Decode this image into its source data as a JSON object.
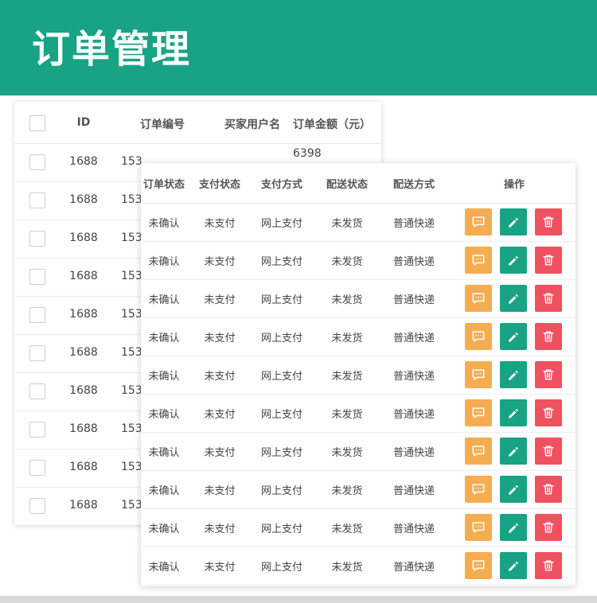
{
  "header": {
    "title": "订单管理"
  },
  "back_table": {
    "columns": [
      "ID",
      "订单编号",
      "买家用户名",
      "订单金额（元）"
    ],
    "rows": [
      {
        "id": "1688",
        "order_no": "153",
        "user": "",
        "amount": ""
      },
      {
        "id": "1688",
        "order_no": "153",
        "user": "",
        "amount": ""
      },
      {
        "id": "1688",
        "order_no": "153",
        "user": "",
        "amount": ""
      },
      {
        "id": "1688",
        "order_no": "153",
        "user": "",
        "amount": ""
      },
      {
        "id": "1688",
        "order_no": "153",
        "user": "",
        "amount": ""
      },
      {
        "id": "1688",
        "order_no": "153",
        "user": "",
        "amount": ""
      },
      {
        "id": "1688",
        "order_no": "153",
        "user": "",
        "amount": ""
      },
      {
        "id": "1688",
        "order_no": "153",
        "user": "",
        "amount": ""
      },
      {
        "id": "1688",
        "order_no": "153",
        "user": "",
        "amount": ""
      },
      {
        "id": "1688",
        "order_no": "153",
        "user": "",
        "amount": ""
      }
    ],
    "first_row_amount": "6398"
  },
  "front_table": {
    "columns": [
      "订单状态",
      "支付状态",
      "支付方式",
      "配送状态",
      "配送方式",
      "操作"
    ],
    "rows": [
      {
        "order_status": "未确认",
        "pay_status": "未支付",
        "pay_method": "网上支付",
        "ship_status": "未发货",
        "ship_method": "普通快递"
      },
      {
        "order_status": "未确认",
        "pay_status": "未支付",
        "pay_method": "网上支付",
        "ship_status": "未发货",
        "ship_method": "普通快递"
      },
      {
        "order_status": "未确认",
        "pay_status": "未支付",
        "pay_method": "网上支付",
        "ship_status": "未发货",
        "ship_method": "普通快递"
      },
      {
        "order_status": "未确认",
        "pay_status": "未支付",
        "pay_method": "网上支付",
        "ship_status": "未发货",
        "ship_method": "普通快递"
      },
      {
        "order_status": "未确认",
        "pay_status": "未支付",
        "pay_method": "网上支付",
        "ship_status": "未发货",
        "ship_method": "普通快递"
      },
      {
        "order_status": "未确认",
        "pay_status": "未支付",
        "pay_method": "网上支付",
        "ship_status": "未发货",
        "ship_method": "普通快递"
      },
      {
        "order_status": "未确认",
        "pay_status": "未支付",
        "pay_method": "网上支付",
        "ship_status": "未发货",
        "ship_method": "普通快递"
      },
      {
        "order_status": "未确认",
        "pay_status": "未支付",
        "pay_method": "网上支付",
        "ship_status": "未发货",
        "ship_method": "普通快递"
      },
      {
        "order_status": "未确认",
        "pay_status": "未支付",
        "pay_method": "网上支付",
        "ship_status": "未发货",
        "ship_method": "普通快递"
      },
      {
        "order_status": "未确认",
        "pay_status": "未支付",
        "pay_method": "网上支付",
        "ship_status": "未发货",
        "ship_method": "普通快递"
      }
    ],
    "actions": [
      {
        "icon": "message-icon",
        "color": "#f5ad52"
      },
      {
        "icon": "edit-pencil-icon",
        "color": "#17a384"
      },
      {
        "icon": "trash-icon",
        "color": "#ee5160"
      }
    ]
  },
  "colors": {
    "brand": "#17a384",
    "warning": "#f5ad52",
    "danger": "#ee5160"
  }
}
